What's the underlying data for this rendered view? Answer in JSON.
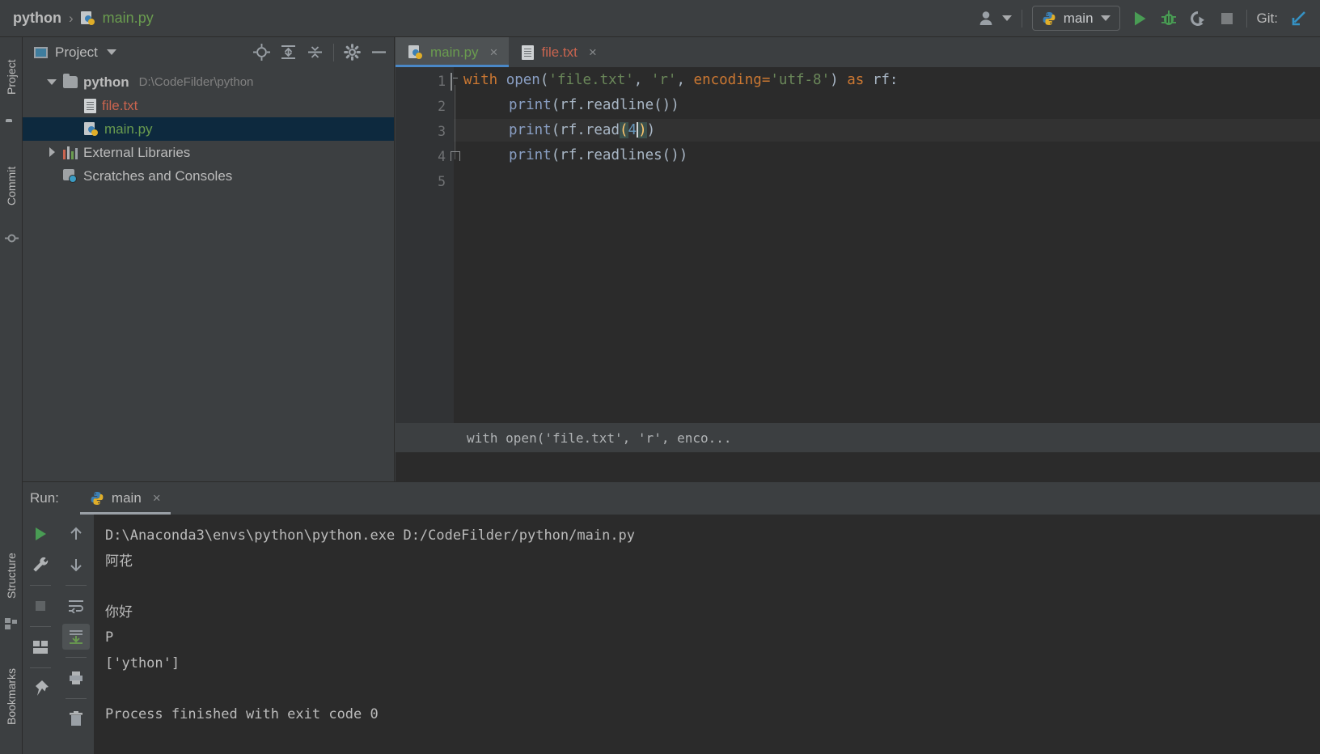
{
  "breadcrumb": {
    "project": "python",
    "separator": "›",
    "file": "main.py"
  },
  "toolbar": {
    "user_icon": "user-avatar-icon",
    "run_config": "main",
    "run_icon": "run-play-icon",
    "debug_icon": "debug-bug-icon",
    "coverage_icon": "run-with-coverage-icon",
    "stop_icon": "stop-square-icon",
    "git_label": "Git:",
    "git_update_icon": "git-update-arrow-icon"
  },
  "stripe": {
    "project_label": "Project",
    "commit_label": "Commit",
    "structure_label": "Structure",
    "bookmarks_label": "Bookmarks"
  },
  "project_panel": {
    "title": "Project",
    "tools": [
      "locate-target-icon",
      "expand-all-icon",
      "collapse-all-icon",
      "settings-gear-icon",
      "hide-minus-icon"
    ],
    "tree": [
      {
        "name": "python",
        "path": "D:\\CodeFilder\\python",
        "icon": "folder-icon",
        "arrow": "down",
        "level": 0,
        "selected": false,
        "color": "default",
        "bold": true
      },
      {
        "name": "file.txt",
        "path": "",
        "icon": "text-file-icon",
        "arrow": "none",
        "level": 1,
        "selected": false,
        "color": "red",
        "bold": false
      },
      {
        "name": "main.py",
        "path": "",
        "icon": "python-file-icon",
        "arrow": "none",
        "level": 1,
        "selected": true,
        "color": "green",
        "bold": false
      },
      {
        "name": "External Libraries",
        "path": "",
        "icon": "library-icon",
        "arrow": "right",
        "level": 0,
        "selected": false,
        "color": "default",
        "bold": false
      },
      {
        "name": "Scratches and Consoles",
        "path": "",
        "icon": "scratches-icon",
        "arrow": "none",
        "level": 0,
        "selected": false,
        "color": "default",
        "bold": false
      }
    ]
  },
  "editor": {
    "tabs": [
      {
        "label": "main.py",
        "icon": "python-file-icon",
        "color": "green",
        "active": true,
        "close": "×"
      },
      {
        "label": "file.txt",
        "icon": "text-file-icon",
        "color": "red",
        "active": false,
        "close": "×"
      }
    ],
    "line_numbers": [
      "1",
      "2",
      "3",
      "4",
      "5"
    ],
    "code": {
      "l1_kw_with": "with",
      "l1_fn_open": "open",
      "l1_paren_open": "(",
      "l1_str_file": "'file.txt'",
      "l1_comma1": ", ",
      "l1_str_r": "'r'",
      "l1_comma2": ", ",
      "l1_kwarg": "encoding",
      "l1_eq": "=",
      "l1_str_enc": "'utf-8'",
      "l1_paren_close": ")",
      "l1_kw_as": " as ",
      "l1_var_rf": "rf",
      "l1_colon": ":",
      "l2_fn_print": "print",
      "l2_body": "(rf.readline())",
      "l3_fn_print": "print",
      "l3_body_a": "(rf.read",
      "l3_bracket_open": "(",
      "l3_num": "4",
      "l3_bracket_close": ")",
      "l3_body_b": ")",
      "l4_fn_print": "print",
      "l4_body": "(rf.readlines())"
    },
    "breadcrumb_text": "with open('file.txt', 'r', enco..."
  },
  "run_panel": {
    "label": "Run:",
    "tab": {
      "label": "main",
      "icon": "python-file-icon",
      "close": "×"
    },
    "side_buttons": [
      "rerun-play-icon",
      "settings-wrench-icon",
      "stop-square-icon",
      "layout-grid-icon",
      "pin-tab-icon"
    ],
    "side_buttons2": [
      "up-arrow-icon",
      "down-arrow-icon",
      "soft-wrap-icon",
      "scroll-to-end-icon",
      "print-icon",
      "clear-all-trash-icon"
    ],
    "console_lines": [
      "D:\\Anaconda3\\envs\\python\\python.exe D:/CodeFilder/python/main.py",
      "阿花",
      "",
      "你好",
      "P",
      "['ython']",
      "",
      "Process finished with exit code 0"
    ]
  },
  "colors": {
    "bg_panel": "#3c3f41",
    "bg_editor": "#2b2b2b",
    "selection": "#0d293e",
    "accent_blue": "#4a88c7",
    "green": "#6a9c4f",
    "red": "#c9644f",
    "keyword_orange": "#cc7832",
    "string_green": "#6a8759",
    "number_blue": "#6897bb"
  }
}
